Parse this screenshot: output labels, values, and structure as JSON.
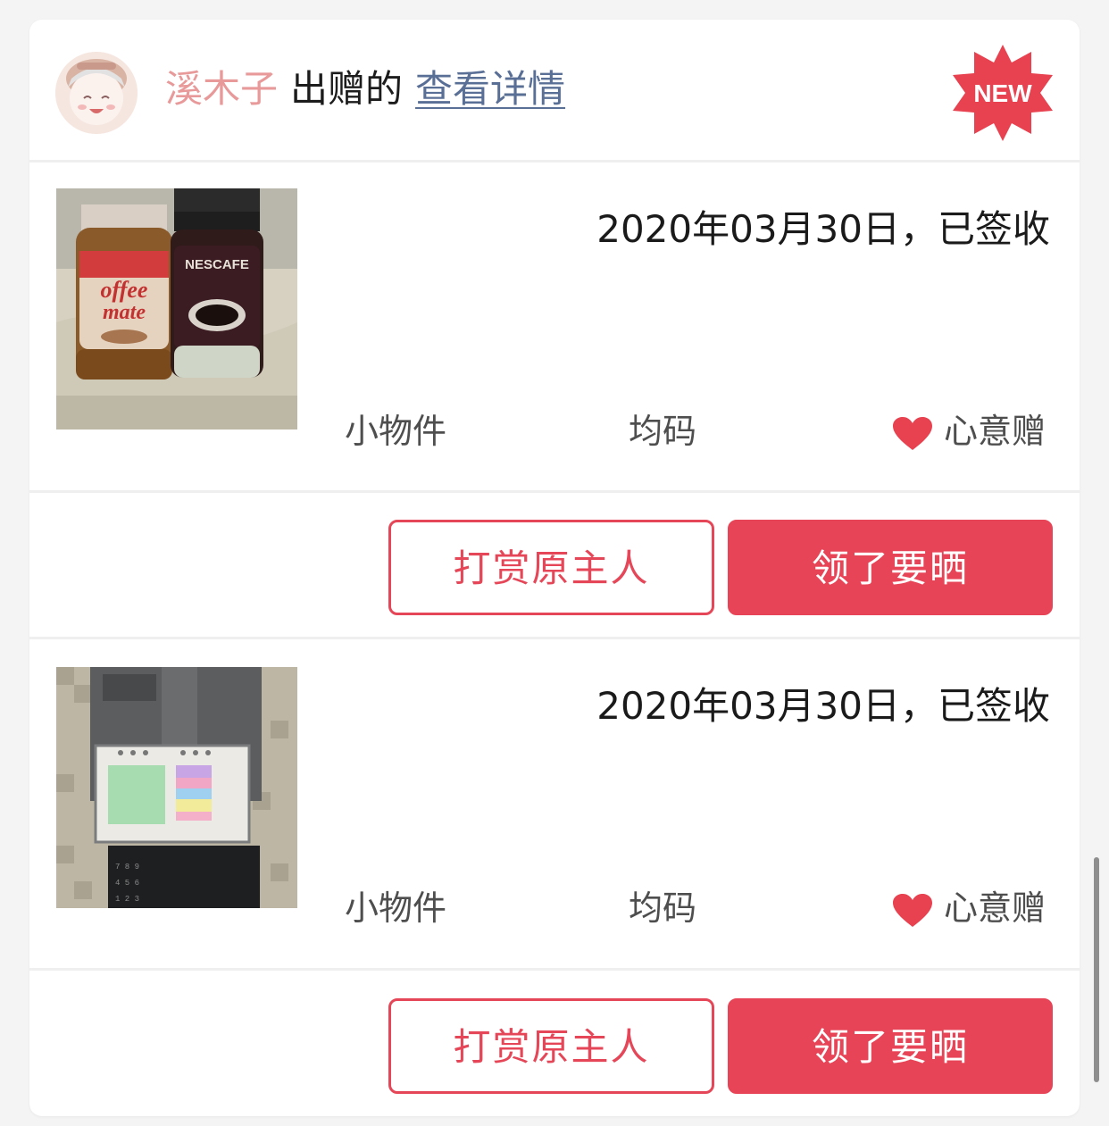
{
  "header": {
    "owner_name": "溪木子",
    "gave_text": "出赠的",
    "detail_link": "查看详情",
    "badge_text": "NEW"
  },
  "items": [
    {
      "status": "2020年03月30日，已签收",
      "category": "小物件",
      "size": "均码",
      "gift_type": "心意赠",
      "image_label": "coffee-mate-and-nescafe-jars",
      "reward_button": "打赏原主人",
      "share_button": "领了要晒"
    },
    {
      "status": "2020年03月30日，已签收",
      "category": "小物件",
      "size": "均码",
      "gift_type": "心意赠",
      "image_label": "notebook-with-sticky-notes",
      "reward_button": "打赏原主人",
      "share_button": "领了要晒"
    }
  ],
  "colors": {
    "accent": "#e84457",
    "owner_name": "#e89a9a",
    "link": "#5a6f96",
    "badge": "#e8414f"
  }
}
